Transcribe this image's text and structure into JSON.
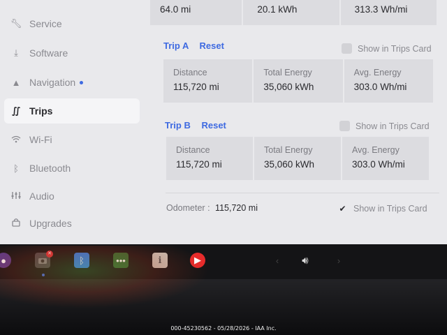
{
  "sidebar": {
    "items": [
      {
        "label": "Service",
        "icon": "wrench-icon"
      },
      {
        "label": "Software",
        "icon": "download-icon"
      },
      {
        "label": "Navigation",
        "icon": "navigation-arrow-icon"
      },
      {
        "label": "Trips",
        "icon": "trips-route-icon"
      },
      {
        "label": "Wi-Fi",
        "icon": "wifi-icon"
      },
      {
        "label": "Bluetooth",
        "icon": "bluetooth-icon"
      },
      {
        "label": "Audio",
        "icon": "equalizer-icon"
      },
      {
        "label": "Upgrades",
        "icon": "lock-bag-icon"
      }
    ],
    "active": "Trips"
  },
  "top_partial": {
    "distance": "64.0 mi",
    "energy": "20.1 kWh",
    "avg": "313.3 Wh/mi"
  },
  "trip_a": {
    "title": "Trip A",
    "reset": "Reset",
    "show_card": "Show in Trips Card",
    "show_card_checked": false,
    "labels": {
      "distance": "Distance",
      "energy": "Total Energy",
      "avg": "Avg. Energy"
    },
    "values": {
      "distance": "115,720 mi",
      "energy": "35,060 kWh",
      "avg": "303.0 Wh/mi"
    }
  },
  "trip_b": {
    "title": "Trip B",
    "reset": "Reset",
    "show_card": "Show in Trips Card",
    "show_card_checked": false,
    "labels": {
      "distance": "Distance",
      "energy": "Total Energy",
      "avg": "Avg. Energy"
    },
    "values": {
      "distance": "115,720 mi",
      "energy": "35,060 kWh",
      "avg": "303.0 Wh/mi"
    }
  },
  "odometer": {
    "label": "Odometer",
    "separator": ":",
    "value": "115,720 mi",
    "show_card": "Show in Trips Card",
    "show_card_checked": true
  },
  "taskbar": {
    "icons": [
      "radio-icon",
      "camera-icon",
      "bluetooth-app-icon",
      "more-apps-icon",
      "toybox-icon",
      "youtube-music-icon",
      "prev-arrow-icon",
      "volume-icon",
      "next-arrow-icon"
    ]
  },
  "colors": {
    "accent": "#3e6ae1",
    "screen_bg": "#e9e9ec",
    "box_bg": "#dcdce0"
  },
  "caption": "000-45230562 - 05/28/2026 - IAA Inc."
}
